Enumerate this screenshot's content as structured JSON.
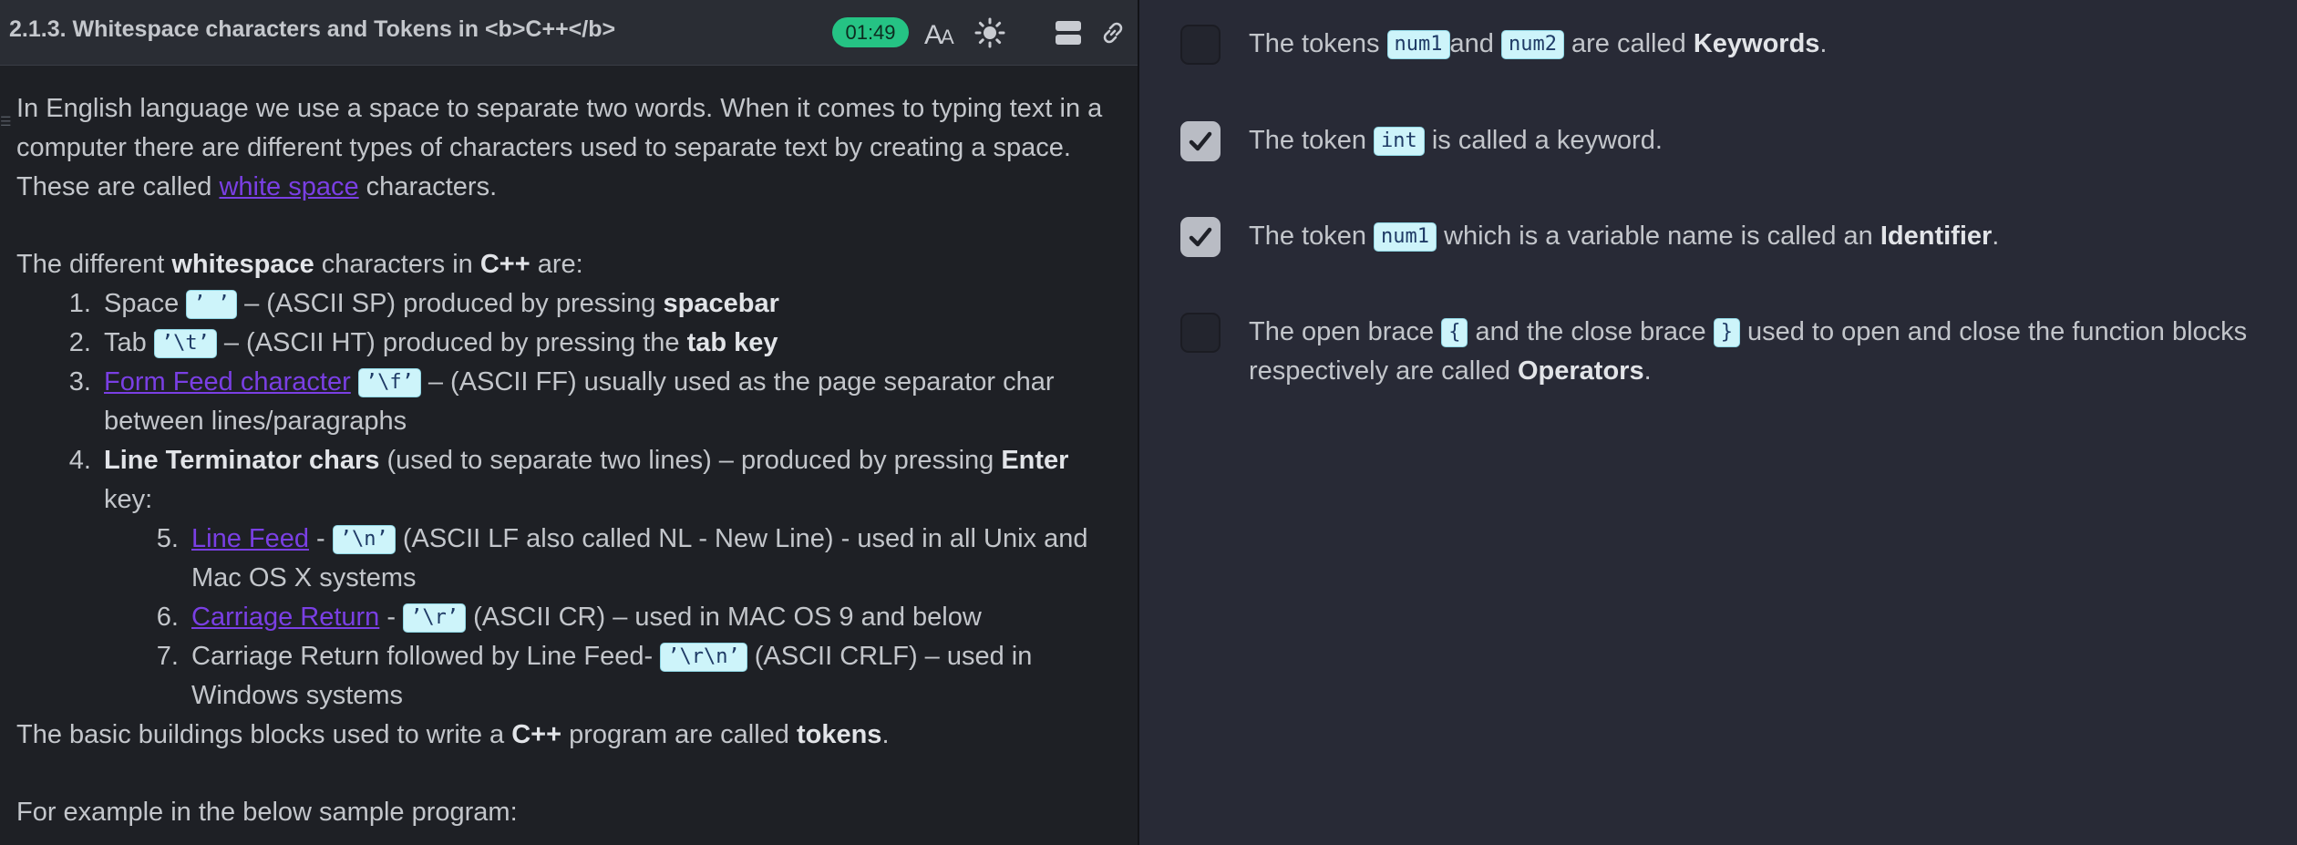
{
  "header": {
    "title": "2.1.3. Whitespace characters and Tokens in <b>C++</b>",
    "timer": "01:49",
    "icons": [
      "font-size-icon",
      "brightness-icon",
      "layout-toggle-icon",
      "link-icon"
    ]
  },
  "lesson": {
    "intro_1": "In English language we use a space to separate two words. When it comes to typing text in a computer there are different types of characters used to separate text by creating a space. These are called ",
    "intro_link": "white space",
    "intro_2": " characters.",
    "list_intro_1": "The different ",
    "list_intro_bold1": "whitespace",
    "list_intro_2": " characters in ",
    "list_intro_bold2": "C++",
    "list_intro_3": " are:",
    "items": [
      {
        "t1": "Space ",
        "code": "’ ’",
        "t2": " – (ASCII SP) produced by pressing ",
        "bold": "spacebar"
      },
      {
        "t1": "Tab ",
        "code": "’\\t’",
        "t2": " – (ASCII HT) produced by pressing the ",
        "bold": "tab key"
      },
      {
        "link": "Form Feed character",
        "code": "’\\f’",
        "t2": " – (ASCII FF) usually used as the page separator char between lines/paragraphs"
      },
      {
        "bold1": "Line Terminator chars",
        "t1": " (used to separate two lines) – produced by pressing ",
        "bold2": "Enter",
        "t2": " key:"
      }
    ],
    "subitems": [
      {
        "link": "Line Feed",
        "t1": " - ",
        "code": "’\\n’",
        "t2": " (ASCII LF also called NL - New Line) - used in all Unix and Mac OS X systems"
      },
      {
        "link": "Carriage Return",
        "t1": " - ",
        "code": "’\\r’",
        "t2": " (ASCII CR) – used in MAC OS 9 and below"
      },
      {
        "t1": "Carriage Return followed by Line Feed- ",
        "code": "’\\r\\n’",
        "t2": " (ASCII CRLF) – used in Windows systems"
      }
    ],
    "tokens_1": "The basic buildings blocks used to write a ",
    "tokens_bold1": "C++",
    "tokens_2": " program are called ",
    "tokens_bold2": "tokens",
    "tokens_3": ".",
    "example": "For example in the below sample program:"
  },
  "options": [
    {
      "checked": false,
      "t1": "The tokens ",
      "code1": "num1",
      "t2": "and ",
      "code2": "num2",
      "t3": " are called ",
      "bold": "Keywords",
      "t4": "."
    },
    {
      "checked": true,
      "t1": "The token ",
      "code1": "int",
      "t2": " is called a keyword."
    },
    {
      "checked": true,
      "t1": "The token ",
      "code1": "num1",
      "t2": " which is a variable name is called an ",
      "bold": "Identifier",
      "t3": "."
    },
    {
      "checked": false,
      "t1": "The open brace ",
      "code1": "{",
      "t2": " and the close brace ",
      "code2": "}",
      "t3": " used to open and close the function blocks respectively are called ",
      "bold": "Operators",
      "t4": "."
    }
  ]
}
